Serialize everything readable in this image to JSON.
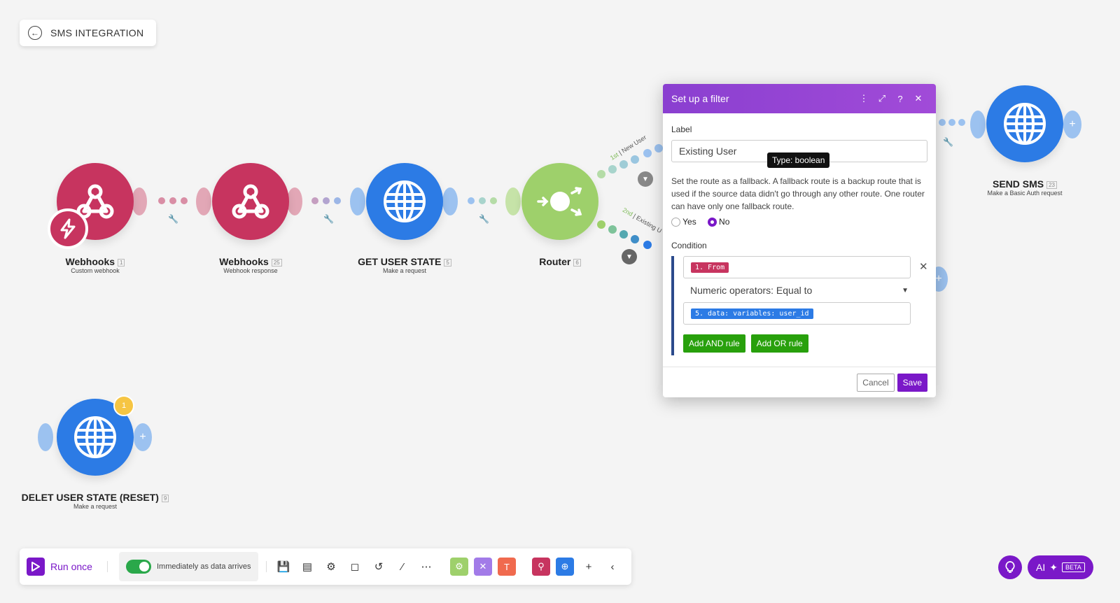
{
  "scenario": {
    "back_label": "SMS INTEGRATION"
  },
  "modules": [
    {
      "title": "Webhooks",
      "id": "1",
      "subtitle": "Custom webhook"
    },
    {
      "title": "Webhooks",
      "id": "25",
      "subtitle": "Webhook response"
    },
    {
      "title": "GET USER STATE",
      "id": "5",
      "subtitle": "Make a request"
    },
    {
      "title": "Router",
      "id": "6",
      "subtitle": ""
    },
    {
      "title": "SEND SMS",
      "id": "23",
      "subtitle": "Make a Basic Auth request"
    },
    {
      "title": "DELET USER STATE (RESET)",
      "id": "9",
      "subtitle": "Make a request",
      "badge": "1"
    }
  ],
  "routes": [
    {
      "order": "1st",
      "label": "New User"
    },
    {
      "order": "2nd",
      "label": "Existing U"
    }
  ],
  "filter_dialog": {
    "title": "Set up a filter",
    "label_caption": "Label",
    "label_value": "Existing User",
    "tooltip": "Type: boolean",
    "fallback_text": "Set the route as a fallback. A fallback route is a backup route that is used if the source data didn't go through any other route. One router can have only one fallback route.",
    "yes_label": "Yes",
    "no_label": "No",
    "fallback_selected": "No",
    "condition_caption": "Condition",
    "operand1": "1. From",
    "operator": "Numeric operators: Equal to",
    "operand2": "5. data: variables: user_id",
    "add_and": "Add AND rule",
    "add_or": "Add OR rule",
    "cancel": "Cancel",
    "save": "Save"
  },
  "toolbar": {
    "run_once": "Run once",
    "schedule_label": "Immediately as data arrives"
  },
  "bottom_right": {
    "ai_label": "AI",
    "beta": "BETA"
  },
  "colors": {
    "accent": "#7a18c8",
    "webhook": "#c7345f",
    "http": "#2c7be5",
    "router": "#9ed06b",
    "green_button": "#28a00c"
  }
}
